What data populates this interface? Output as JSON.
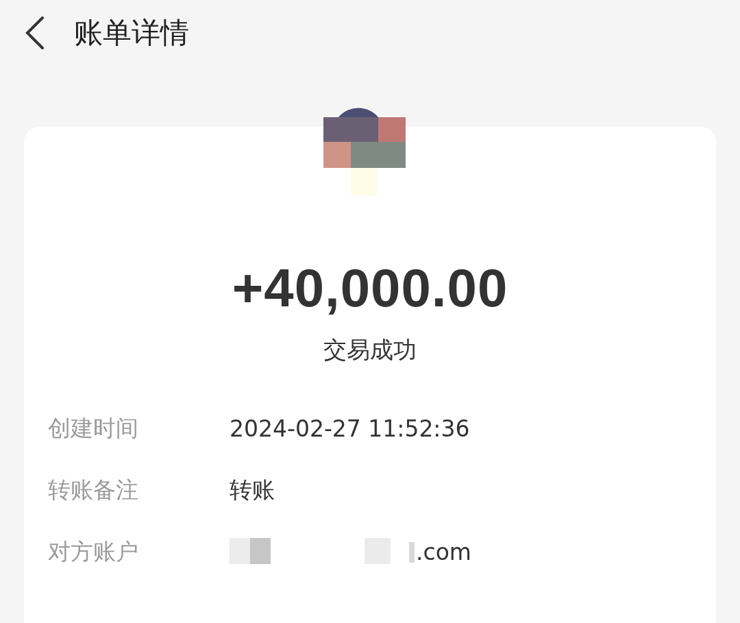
{
  "header": {
    "title": "账单详情"
  },
  "amount": "+40,000.00",
  "status": "交易成功",
  "details": [
    {
      "label": "创建时间",
      "value": "2024-02-27 11:52:36",
      "redacted": false
    },
    {
      "label": "转账备注",
      "value": "转账",
      "redacted": false
    },
    {
      "label": "对方账户",
      "value": ".com",
      "redacted": true
    }
  ]
}
